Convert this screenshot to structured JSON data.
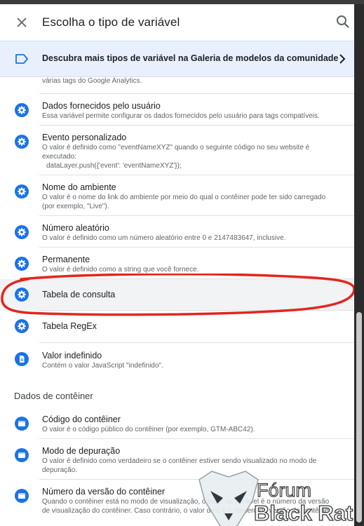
{
  "header": {
    "title": "Escolha o tipo de variável"
  },
  "banner": {
    "text": "Descubra mais tipos de variável na Galeria de modelos da comunidade"
  },
  "truncated_text": "várias tags do Google Analytics.",
  "rows": [
    {
      "title": "Dados fornecidos pelo usuário",
      "desc": "Essa variável permite configurar os dados fornecidos pelo usuário para tags compatíveis.",
      "icon": "gear-icon"
    },
    {
      "title": "Evento personalizado",
      "desc": "O valor é definido como \"eventNameXYZ\" quando o seguinte código no seu website é executado:",
      "code": "dataLayer.push({'event': 'eventNameXYZ'});",
      "icon": "gear-icon"
    },
    {
      "title": "Nome do ambiente",
      "desc": "O valor é o nome do link do ambiente por meio do qual o contêiner pode ter sido carregado (por exemplo, \"Live\").",
      "icon": "gear-icon"
    },
    {
      "title": "Número aleatório",
      "desc": "O valor é definido como um número aleatório entre 0 e 2147483647, inclusive.",
      "icon": "gear-icon"
    },
    {
      "title": "Permanente",
      "desc": "O valor é definido como a string que você fornece.",
      "icon": "gear-icon"
    },
    {
      "title": "Tabela de consulta",
      "icon": "gear-icon"
    },
    {
      "title": "Tabela RegEx",
      "icon": "gear-icon"
    },
    {
      "title": "Valor indefinido",
      "desc": "Contém o valor JavaScript \"indefinido\".",
      "icon": "document-icon"
    }
  ],
  "container_section": {
    "title": "Dados de contêiner",
    "rows": [
      {
        "title": "Código do contêiner",
        "desc": "O valor é o código público do contêiner (por exemplo, GTM-ABC42).",
        "icon": "container-icon"
      },
      {
        "title": "Modo de depuração",
        "desc": "O valor é definido como verdadeiro se o contêiner estiver sendo visualizado no modo de depuração.",
        "icon": "container-icon"
      },
      {
        "title": "Número da versão do contêiner",
        "desc": "Quando o contêiner está no modo de visualização, o valor da variável é o número da versão de visualização do contêiner. Caso contrário, o valor dela é o número da versão do contêiner.",
        "icon": "container-icon"
      }
    ]
  },
  "watermark": {
    "line1": "Fórum",
    "line2": "Black Rat"
  },
  "colors": {
    "accent_blue": "#1a73e8",
    "annotation_red": "#e3261d",
    "banner_bg": "#e8f0fe",
    "highlight_bg": "#f1f3f4"
  }
}
